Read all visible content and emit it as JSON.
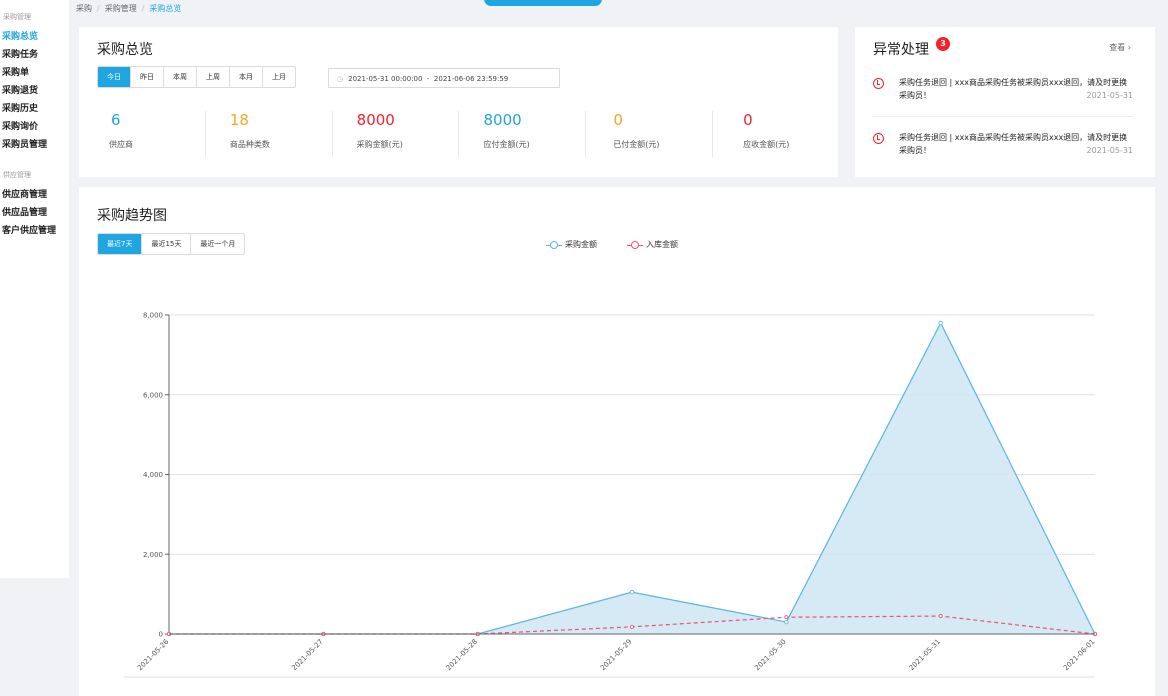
{
  "sidebar": {
    "groups": [
      {
        "title": "采购管理",
        "items": [
          "采购总览",
          "采购任务",
          "采购单",
          "采购退货",
          "采购历史",
          "采购询价",
          "采购员管理"
        ]
      },
      {
        "title": "供应管理",
        "items": [
          "供应商管理",
          "供应品管理",
          "客户供应管理"
        ]
      }
    ]
  },
  "breadcrumb": [
    "采购",
    "采购管理",
    "采购总览"
  ],
  "overview": {
    "title": "采购总览",
    "range_tabs": [
      "今日",
      "昨日",
      "本周",
      "上周",
      "本月",
      "上月"
    ],
    "date_start": "2021-05-31 00:00:00",
    "date_sep": "-",
    "date_end": "2021-06-06 23:59:59",
    "stats": [
      {
        "value": "6",
        "label": "供应商",
        "color": "#1fa5e0"
      },
      {
        "value": "18",
        "label": "商品种类数",
        "color": "#f5a623"
      },
      {
        "value": "8000",
        "label": "采购金额(元)",
        "color": "#f5222d"
      },
      {
        "value": "8000",
        "label": "应付金额(元)",
        "color": "#1fa5e0"
      },
      {
        "value": "0",
        "label": "已付金额(元)",
        "color": "#f5a623"
      },
      {
        "value": "0",
        "label": "应收金额(元)",
        "color": "#f5222d"
      }
    ]
  },
  "alerts": {
    "title": "异常处理",
    "count": "3",
    "view_all": "查看",
    "items": [
      {
        "text": "采购任务退回 | xxx商品采购任务被采购员xxx退回，请及时更换采购员！",
        "date": "2021-05-31"
      },
      {
        "text": "采购任务退回 | xxx商品采购任务被采购员xxx退回，请及时更换采购员！",
        "date": "2021-05-31"
      }
    ]
  },
  "trend": {
    "title": "采购趋势图",
    "range_tabs": [
      "最近7天",
      "最近15天",
      "最近一个月"
    ]
  },
  "chart_data": {
    "type": "area",
    "x": [
      "2021-05-26",
      "2021-05-27",
      "2021-05-28",
      "2021-05-29",
      "2021-05-30",
      "2021-05-31",
      "2021-06-01"
    ],
    "series": [
      {
        "name": "采购金额",
        "values": [
          0,
          0,
          0,
          1050,
          300,
          7800,
          0
        ],
        "color": "#5ab4e0"
      },
      {
        "name": "入库金额",
        "values": [
          0,
          0,
          0,
          180,
          420,
          450,
          0
        ],
        "color": "#f0506e"
      }
    ],
    "ylim": [
      0,
      8000
    ],
    "yticks": [
      "0",
      "2,000",
      "4,000",
      "6,000",
      "8,000"
    ],
    "grid": true,
    "legend": "top-center"
  }
}
